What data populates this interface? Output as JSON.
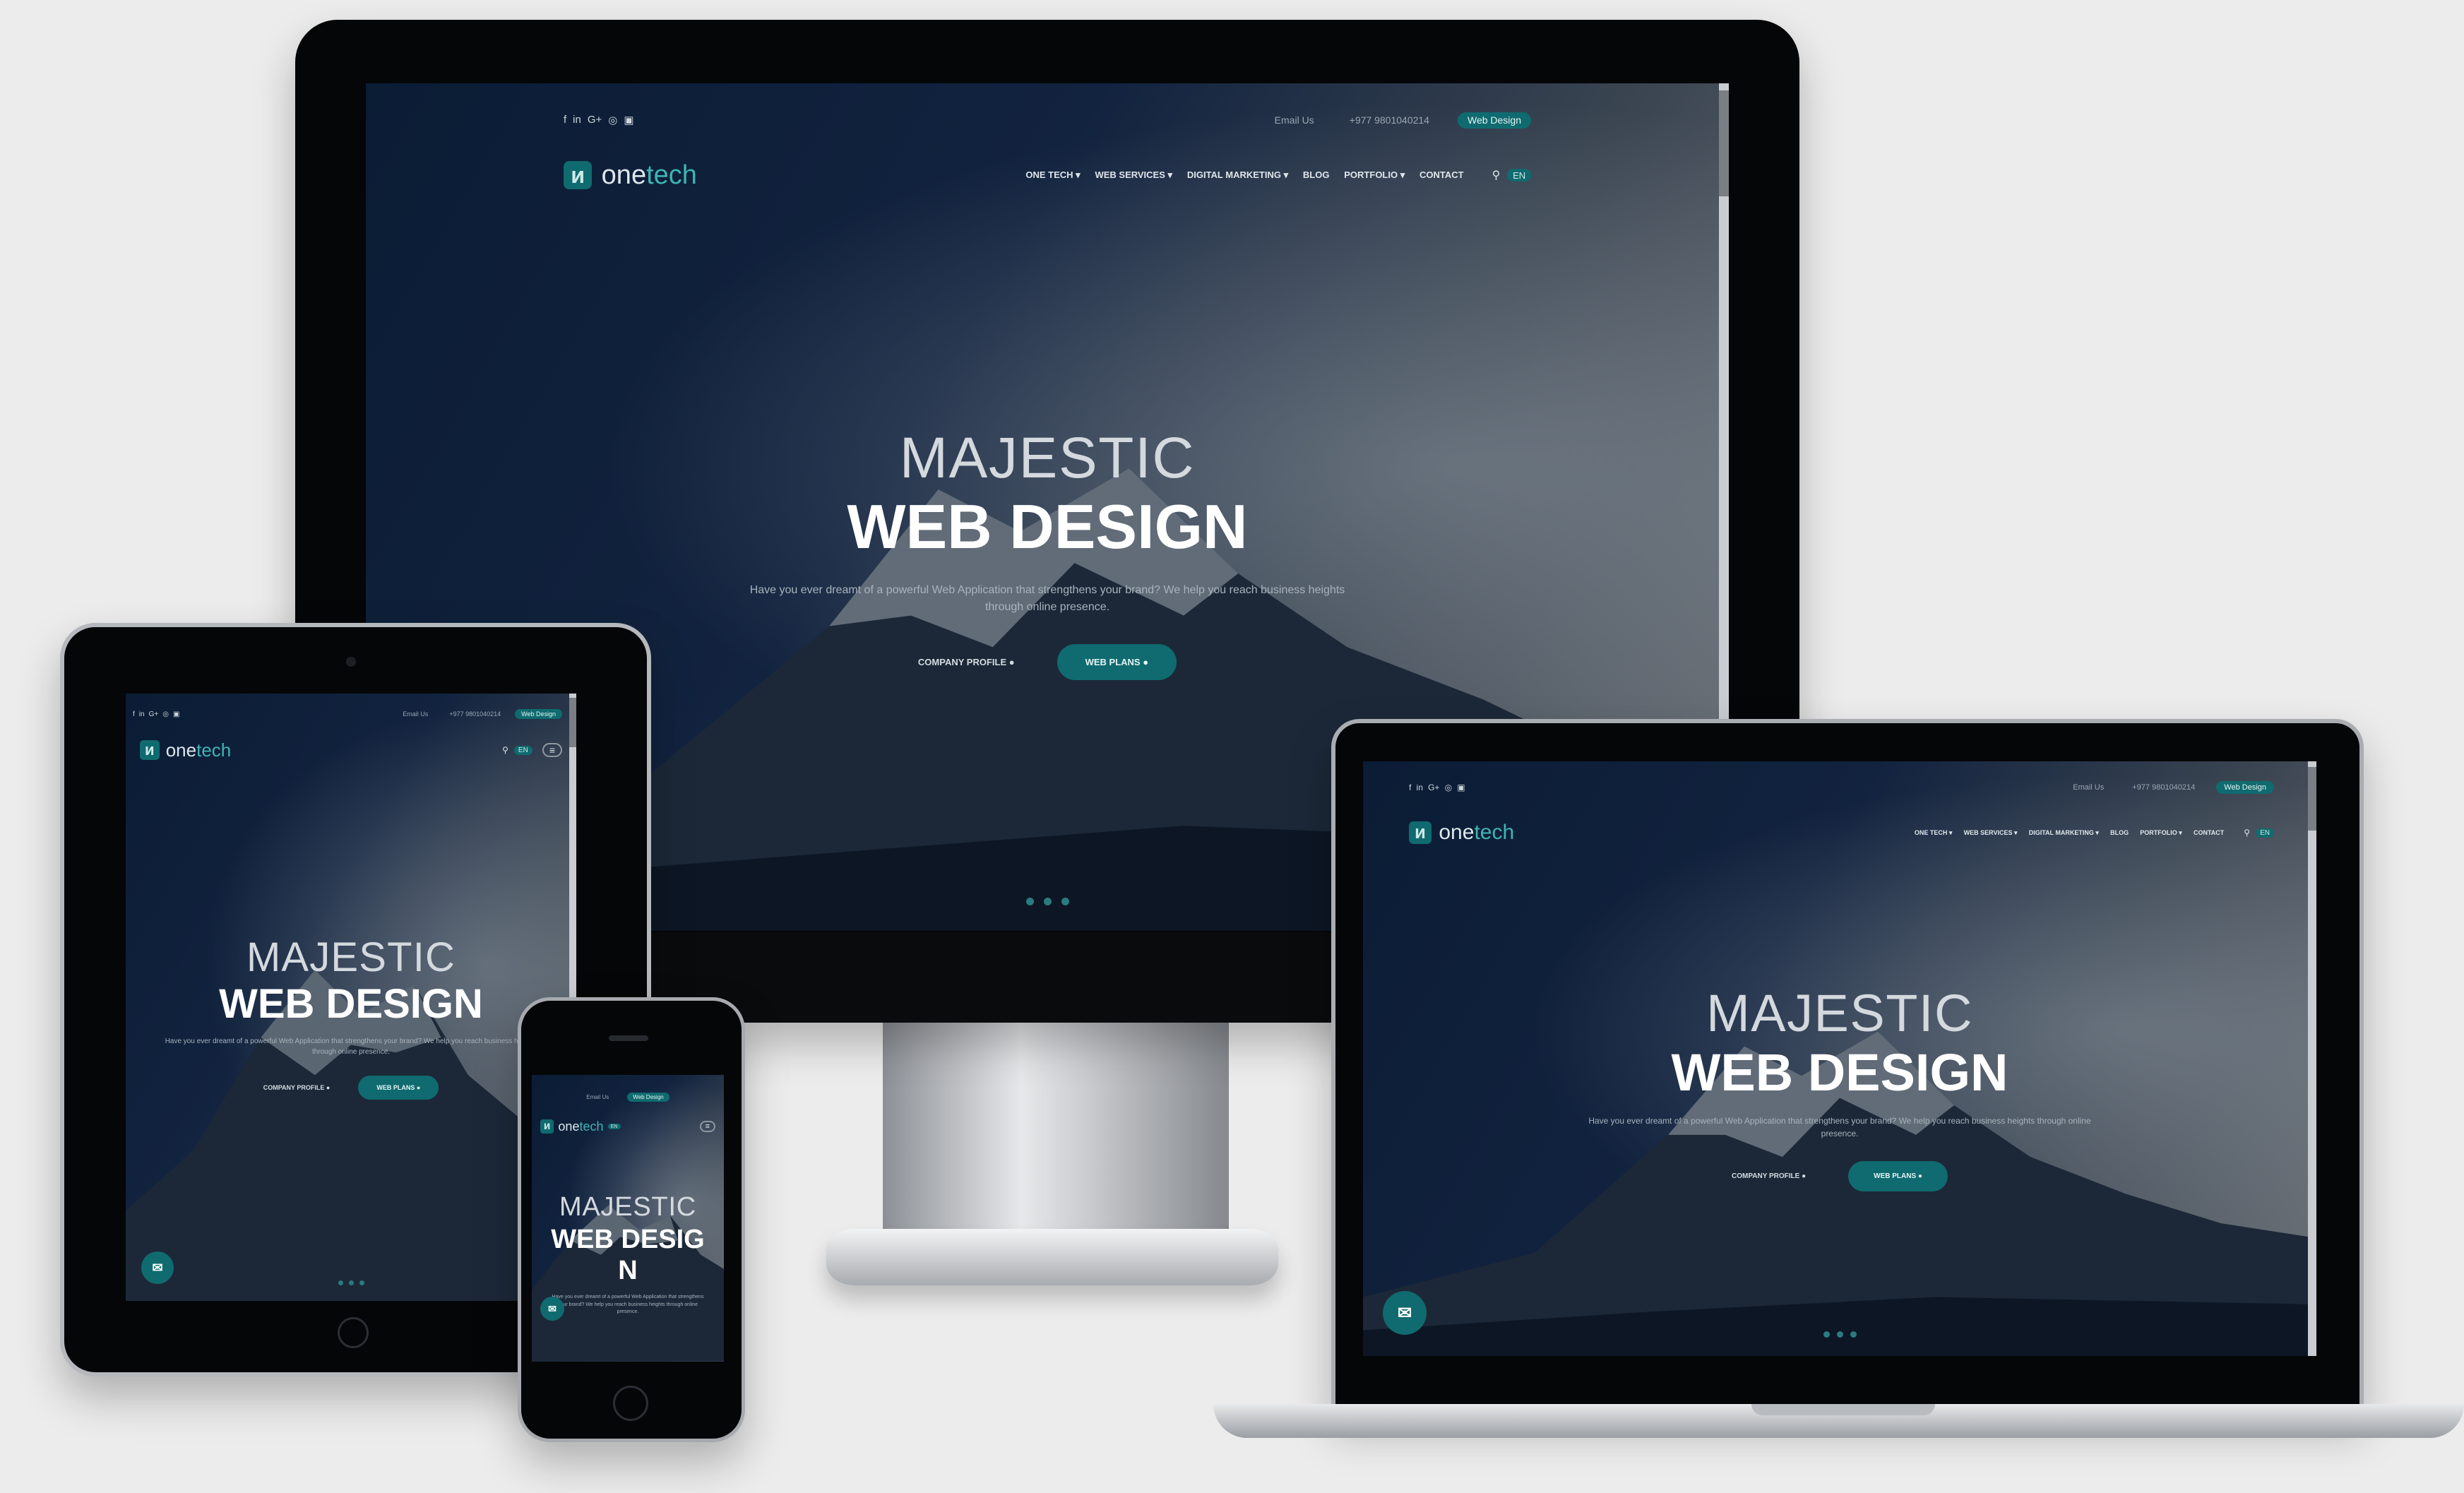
{
  "site": {
    "social_icons": [
      "facebook-icon",
      "linkedin-icon",
      "google-plus-icon",
      "instagram-icon",
      "youtube-icon"
    ],
    "social_glyphs": [
      "f",
      "in",
      "G+",
      "◎",
      "▣"
    ],
    "email_label": "Email Us",
    "phone": "+977 9801040214",
    "cta_pill": "Web Design",
    "logo_one": "one",
    "logo_tech": "tech",
    "logo_glyph": "ᴎ",
    "menu": [
      "ONE TECH ▾",
      "WEB SERVICES ▾",
      "DIGITAL MARKETING ▾",
      "BLOG",
      "PORTFOLIO ▾",
      "CONTACT"
    ],
    "search_glyph": "⚲",
    "lang": "EN",
    "hero_line1": "MAJESTIC",
    "hero_line2": "WEB DESIGN",
    "hero_text": "Have you ever dreamt of a powerful Web Application that strengthens your brand? We help you reach business heights through online presence.",
    "btn_profile": "COMPANY PROFILE ●",
    "btn_plans": "WEB PLANS ●",
    "phone_hero_line2a": "WEB DESIG",
    "phone_hero_line2b": "N",
    "chat_glyph": "✉"
  },
  "colors": {
    "accent": "#0f6b6f",
    "bezel": "#050608",
    "background": "#ececec"
  }
}
